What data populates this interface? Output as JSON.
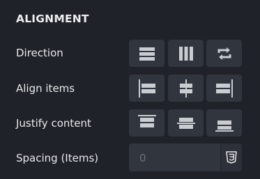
{
  "section": {
    "title": "ALIGNMENT"
  },
  "rows": {
    "direction": {
      "label": "Direction"
    },
    "align_items": {
      "label": "Align items"
    },
    "justify_content": {
      "label": "Justify content"
    },
    "spacing": {
      "label": "Spacing (Items)",
      "placeholder": "0",
      "unit_icon": "css3-icon"
    }
  },
  "icons": {
    "direction": [
      "direction-column-icon",
      "direction-row-icon",
      "direction-reverse-icon"
    ],
    "align_items": [
      "align-start-icon",
      "align-center-icon",
      "align-end-icon"
    ],
    "justify_content": [
      "justify-start-icon",
      "justify-center-icon",
      "justify-end-icon"
    ]
  },
  "colors": {
    "background": "#1f2228",
    "button": "#31353d",
    "icon": "#c9ccd1"
  }
}
